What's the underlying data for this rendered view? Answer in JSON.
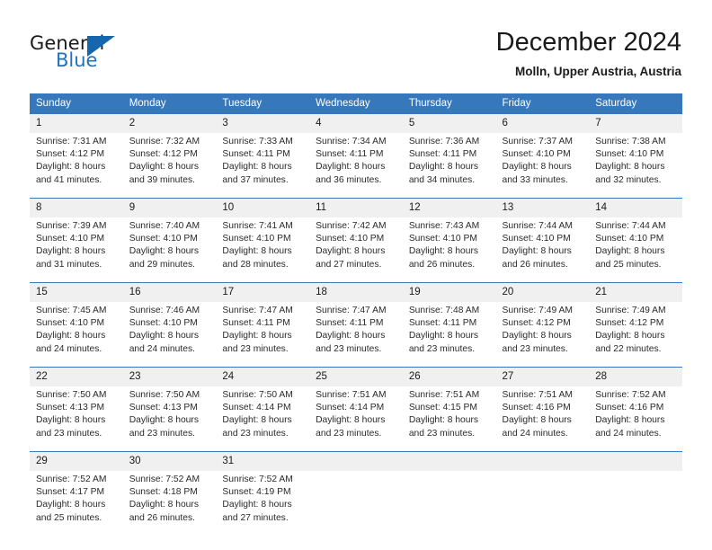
{
  "brand": {
    "name_part1": "General",
    "name_part2": "Blue",
    "triangle_color": "#1566ac",
    "blue_text_color": "#2372b9"
  },
  "header": {
    "title": "December 2024",
    "subtitle": "Molln, Upper Austria, Austria"
  },
  "theme": {
    "header_blue": "#3778bc",
    "daynum_band": "#f0f0f0",
    "text": "#222222"
  },
  "weekdays": [
    "Sunday",
    "Monday",
    "Tuesday",
    "Wednesday",
    "Thursday",
    "Friday",
    "Saturday"
  ],
  "weeks": [
    [
      {
        "day": "1",
        "sunrise": "Sunrise: 7:31 AM",
        "sunset": "Sunset: 4:12 PM",
        "daylight1": "Daylight: 8 hours",
        "daylight2": "and 41 minutes."
      },
      {
        "day": "2",
        "sunrise": "Sunrise: 7:32 AM",
        "sunset": "Sunset: 4:12 PM",
        "daylight1": "Daylight: 8 hours",
        "daylight2": "and 39 minutes."
      },
      {
        "day": "3",
        "sunrise": "Sunrise: 7:33 AM",
        "sunset": "Sunset: 4:11 PM",
        "daylight1": "Daylight: 8 hours",
        "daylight2": "and 37 minutes."
      },
      {
        "day": "4",
        "sunrise": "Sunrise: 7:34 AM",
        "sunset": "Sunset: 4:11 PM",
        "daylight1": "Daylight: 8 hours",
        "daylight2": "and 36 minutes."
      },
      {
        "day": "5",
        "sunrise": "Sunrise: 7:36 AM",
        "sunset": "Sunset: 4:11 PM",
        "daylight1": "Daylight: 8 hours",
        "daylight2": "and 34 minutes."
      },
      {
        "day": "6",
        "sunrise": "Sunrise: 7:37 AM",
        "sunset": "Sunset: 4:10 PM",
        "daylight1": "Daylight: 8 hours",
        "daylight2": "and 33 minutes."
      },
      {
        "day": "7",
        "sunrise": "Sunrise: 7:38 AM",
        "sunset": "Sunset: 4:10 PM",
        "daylight1": "Daylight: 8 hours",
        "daylight2": "and 32 minutes."
      }
    ],
    [
      {
        "day": "8",
        "sunrise": "Sunrise: 7:39 AM",
        "sunset": "Sunset: 4:10 PM",
        "daylight1": "Daylight: 8 hours",
        "daylight2": "and 31 minutes."
      },
      {
        "day": "9",
        "sunrise": "Sunrise: 7:40 AM",
        "sunset": "Sunset: 4:10 PM",
        "daylight1": "Daylight: 8 hours",
        "daylight2": "and 29 minutes."
      },
      {
        "day": "10",
        "sunrise": "Sunrise: 7:41 AM",
        "sunset": "Sunset: 4:10 PM",
        "daylight1": "Daylight: 8 hours",
        "daylight2": "and 28 minutes."
      },
      {
        "day": "11",
        "sunrise": "Sunrise: 7:42 AM",
        "sunset": "Sunset: 4:10 PM",
        "daylight1": "Daylight: 8 hours",
        "daylight2": "and 27 minutes."
      },
      {
        "day": "12",
        "sunrise": "Sunrise: 7:43 AM",
        "sunset": "Sunset: 4:10 PM",
        "daylight1": "Daylight: 8 hours",
        "daylight2": "and 26 minutes."
      },
      {
        "day": "13",
        "sunrise": "Sunrise: 7:44 AM",
        "sunset": "Sunset: 4:10 PM",
        "daylight1": "Daylight: 8 hours",
        "daylight2": "and 26 minutes."
      },
      {
        "day": "14",
        "sunrise": "Sunrise: 7:44 AM",
        "sunset": "Sunset: 4:10 PM",
        "daylight1": "Daylight: 8 hours",
        "daylight2": "and 25 minutes."
      }
    ],
    [
      {
        "day": "15",
        "sunrise": "Sunrise: 7:45 AM",
        "sunset": "Sunset: 4:10 PM",
        "daylight1": "Daylight: 8 hours",
        "daylight2": "and 24 minutes."
      },
      {
        "day": "16",
        "sunrise": "Sunrise: 7:46 AM",
        "sunset": "Sunset: 4:10 PM",
        "daylight1": "Daylight: 8 hours",
        "daylight2": "and 24 minutes."
      },
      {
        "day": "17",
        "sunrise": "Sunrise: 7:47 AM",
        "sunset": "Sunset: 4:11 PM",
        "daylight1": "Daylight: 8 hours",
        "daylight2": "and 23 minutes."
      },
      {
        "day": "18",
        "sunrise": "Sunrise: 7:47 AM",
        "sunset": "Sunset: 4:11 PM",
        "daylight1": "Daylight: 8 hours",
        "daylight2": "and 23 minutes."
      },
      {
        "day": "19",
        "sunrise": "Sunrise: 7:48 AM",
        "sunset": "Sunset: 4:11 PM",
        "daylight1": "Daylight: 8 hours",
        "daylight2": "and 23 minutes."
      },
      {
        "day": "20",
        "sunrise": "Sunrise: 7:49 AM",
        "sunset": "Sunset: 4:12 PM",
        "daylight1": "Daylight: 8 hours",
        "daylight2": "and 23 minutes."
      },
      {
        "day": "21",
        "sunrise": "Sunrise: 7:49 AM",
        "sunset": "Sunset: 4:12 PM",
        "daylight1": "Daylight: 8 hours",
        "daylight2": "and 22 minutes."
      }
    ],
    [
      {
        "day": "22",
        "sunrise": "Sunrise: 7:50 AM",
        "sunset": "Sunset: 4:13 PM",
        "daylight1": "Daylight: 8 hours",
        "daylight2": "and 23 minutes."
      },
      {
        "day": "23",
        "sunrise": "Sunrise: 7:50 AM",
        "sunset": "Sunset: 4:13 PM",
        "daylight1": "Daylight: 8 hours",
        "daylight2": "and 23 minutes."
      },
      {
        "day": "24",
        "sunrise": "Sunrise: 7:50 AM",
        "sunset": "Sunset: 4:14 PM",
        "daylight1": "Daylight: 8 hours",
        "daylight2": "and 23 minutes."
      },
      {
        "day": "25",
        "sunrise": "Sunrise: 7:51 AM",
        "sunset": "Sunset: 4:14 PM",
        "daylight1": "Daylight: 8 hours",
        "daylight2": "and 23 minutes."
      },
      {
        "day": "26",
        "sunrise": "Sunrise: 7:51 AM",
        "sunset": "Sunset: 4:15 PM",
        "daylight1": "Daylight: 8 hours",
        "daylight2": "and 23 minutes."
      },
      {
        "day": "27",
        "sunrise": "Sunrise: 7:51 AM",
        "sunset": "Sunset: 4:16 PM",
        "daylight1": "Daylight: 8 hours",
        "daylight2": "and 24 minutes."
      },
      {
        "day": "28",
        "sunrise": "Sunrise: 7:52 AM",
        "sunset": "Sunset: 4:16 PM",
        "daylight1": "Daylight: 8 hours",
        "daylight2": "and 24 minutes."
      }
    ],
    [
      {
        "day": "29",
        "sunrise": "Sunrise: 7:52 AM",
        "sunset": "Sunset: 4:17 PM",
        "daylight1": "Daylight: 8 hours",
        "daylight2": "and 25 minutes."
      },
      {
        "day": "30",
        "sunrise": "Sunrise: 7:52 AM",
        "sunset": "Sunset: 4:18 PM",
        "daylight1": "Daylight: 8 hours",
        "daylight2": "and 26 minutes."
      },
      {
        "day": "31",
        "sunrise": "Sunrise: 7:52 AM",
        "sunset": "Sunset: 4:19 PM",
        "daylight1": "Daylight: 8 hours",
        "daylight2": "and 27 minutes."
      },
      {
        "day": "",
        "sunrise": "",
        "sunset": "",
        "daylight1": "",
        "daylight2": ""
      },
      {
        "day": "",
        "sunrise": "",
        "sunset": "",
        "daylight1": "",
        "daylight2": ""
      },
      {
        "day": "",
        "sunrise": "",
        "sunset": "",
        "daylight1": "",
        "daylight2": ""
      },
      {
        "day": "",
        "sunrise": "",
        "sunset": "",
        "daylight1": "",
        "daylight2": ""
      }
    ]
  ]
}
